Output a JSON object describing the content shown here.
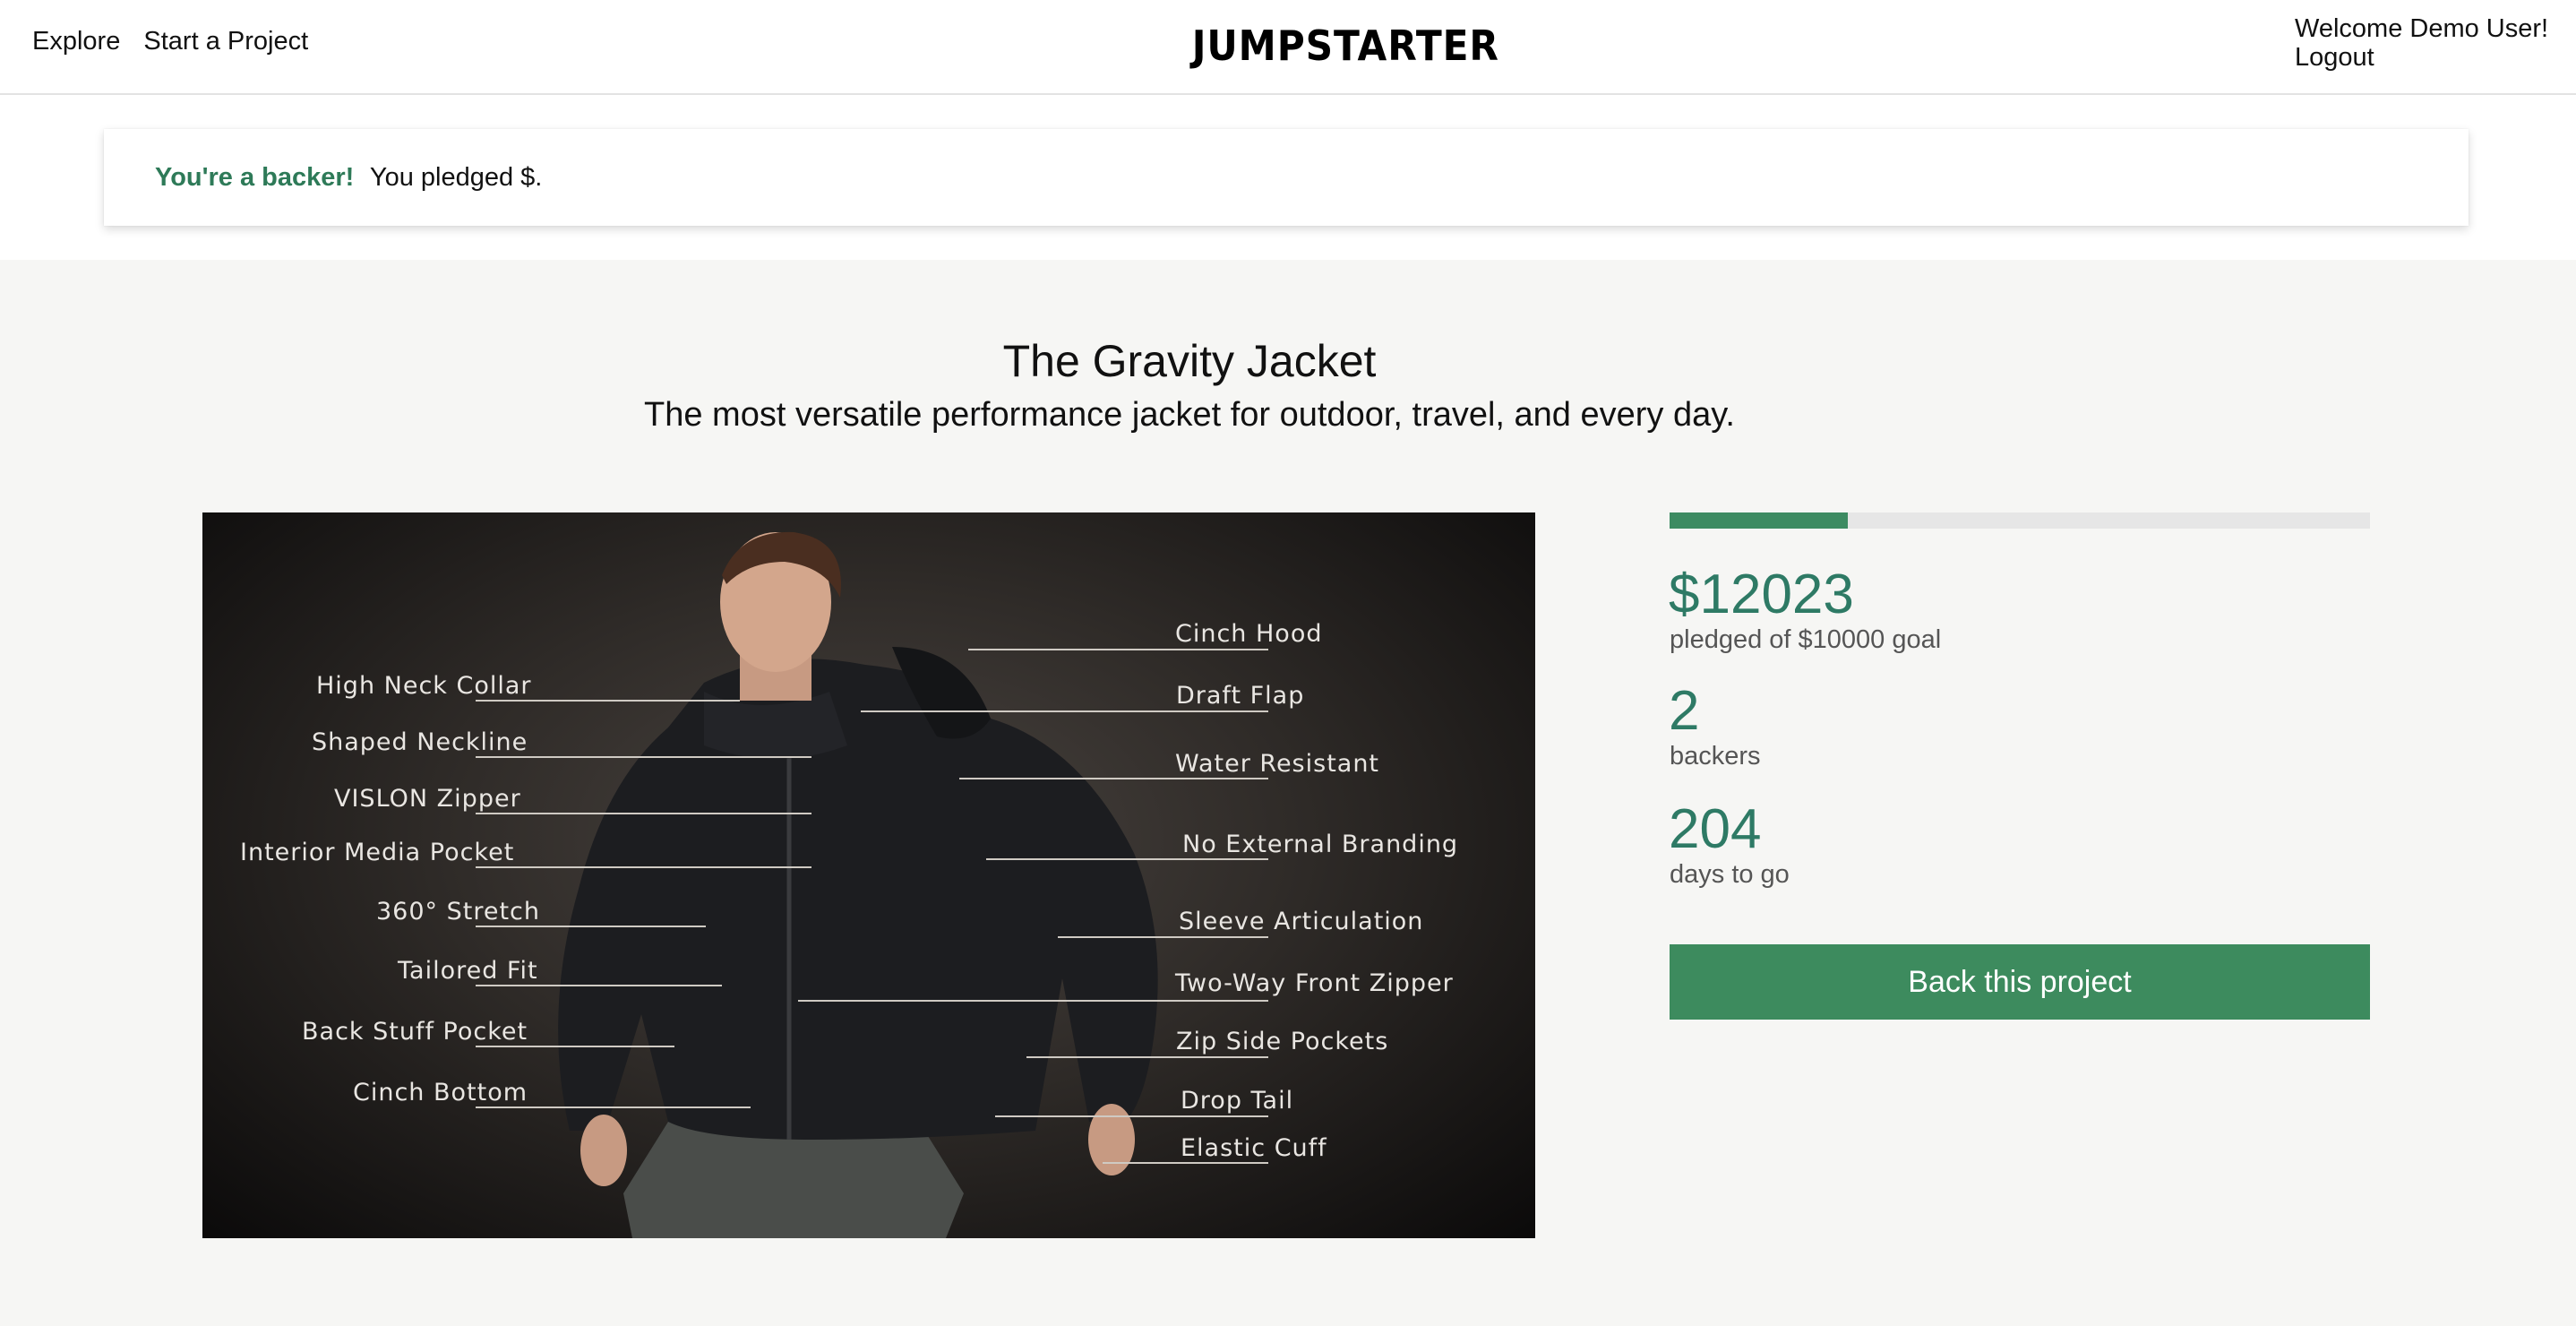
{
  "nav": {
    "explore_label": "Explore",
    "start_project_label": "Start a Project",
    "logo_text": "JUMPSTARTER",
    "welcome_text": "Welcome Demo User!",
    "logout_label": "Logout"
  },
  "banner": {
    "strong_text": "You're a backer!",
    "message": "You pledged $."
  },
  "project": {
    "title": "The Gravity Jacket",
    "subtitle": "The most versatile performance jacket for outdoor, travel, and every day.",
    "image_labels_left": [
      "High Neck Collar",
      "Shaped Neckline",
      "VISLON Zipper",
      "Interior Media Pocket",
      "360° Stretch",
      "Tailored Fit",
      "Back Stuff Pocket",
      "Cinch Bottom"
    ],
    "image_labels_right": [
      "Cinch Hood",
      "Draft Flap",
      "Water Resistant",
      "No External Branding",
      "Sleeve Articulation",
      "Two-Way Front Zipper",
      "Zip Side Pockets",
      "Drop Tail",
      "Elastic Cuff"
    ]
  },
  "stats": {
    "progress_fraction": 0.255,
    "pledged": "$12023",
    "pledged_label": "pledged of $10000 goal",
    "backers": "2",
    "backers_label": "backers",
    "days": "204",
    "days_label": "days to go"
  },
  "cta": {
    "back_label": "Back this project"
  },
  "colors": {
    "accent_green": "#2e7a65",
    "button_green": "#3d8b5e",
    "progress_green": "#3d8b62",
    "background": "#f6f6f4"
  }
}
